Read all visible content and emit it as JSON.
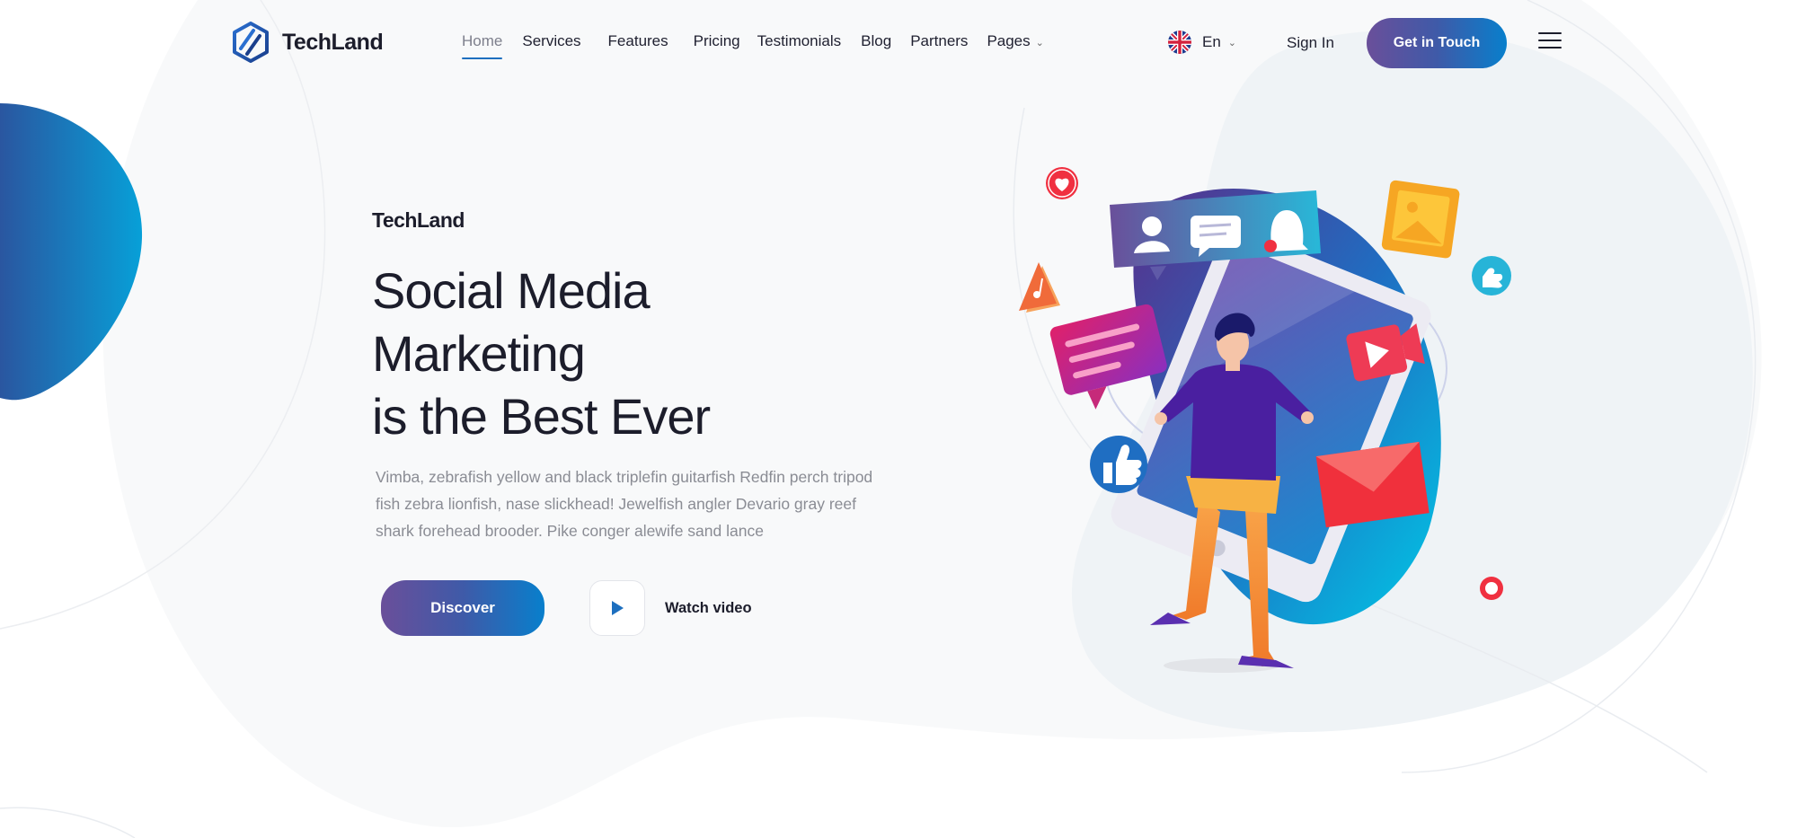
{
  "header": {
    "logo_text": "TechLand",
    "nav": [
      {
        "label": "Home",
        "active": true
      },
      {
        "label": "Services",
        "active": false
      },
      {
        "label": "Features",
        "active": false
      },
      {
        "label": "Pricing",
        "active": false
      },
      {
        "label": "Testimonials",
        "active": false
      },
      {
        "label": "Blog",
        "active": false
      },
      {
        "label": "Partners",
        "active": false
      },
      {
        "label": "Pages",
        "active": false,
        "has_dropdown": true
      }
    ],
    "language": "En",
    "language_icon": "uk-flag-icon",
    "signin_label": "Sign In",
    "cta_label": "Get in Touch",
    "menu_icon": "hamburger-menu-icon"
  },
  "hero": {
    "brand": "TechLand",
    "title_lines": [
      "Social Media",
      "Marketing",
      "is the Best Ever"
    ],
    "description": "Vimba, zebrafish yellow and black triplefin guitarfish Redfin perch tripod fish zebra lionfish, nase slickhead! Jewelfish angler Devario gray reef shark forehead brooder. Pike conger alewife sand lance",
    "primary_button": "Discover",
    "video_label": "Watch video",
    "play_icon": "play-icon"
  },
  "illustration": {
    "icons": [
      "heart-icon",
      "music-note-icon",
      "user-icon",
      "chat-icon",
      "bell-icon",
      "image-icon",
      "thumbs-up-icon",
      "message-bubble-icon",
      "video-icon",
      "envelope-icon"
    ]
  },
  "colors": {
    "accent_gradient_start": "#6a4f9a",
    "accent_gradient_end": "#087fcc",
    "text_dark": "#1c1d2b",
    "text_muted": "#8a8c94",
    "active_underline": "#1d6fbf"
  }
}
